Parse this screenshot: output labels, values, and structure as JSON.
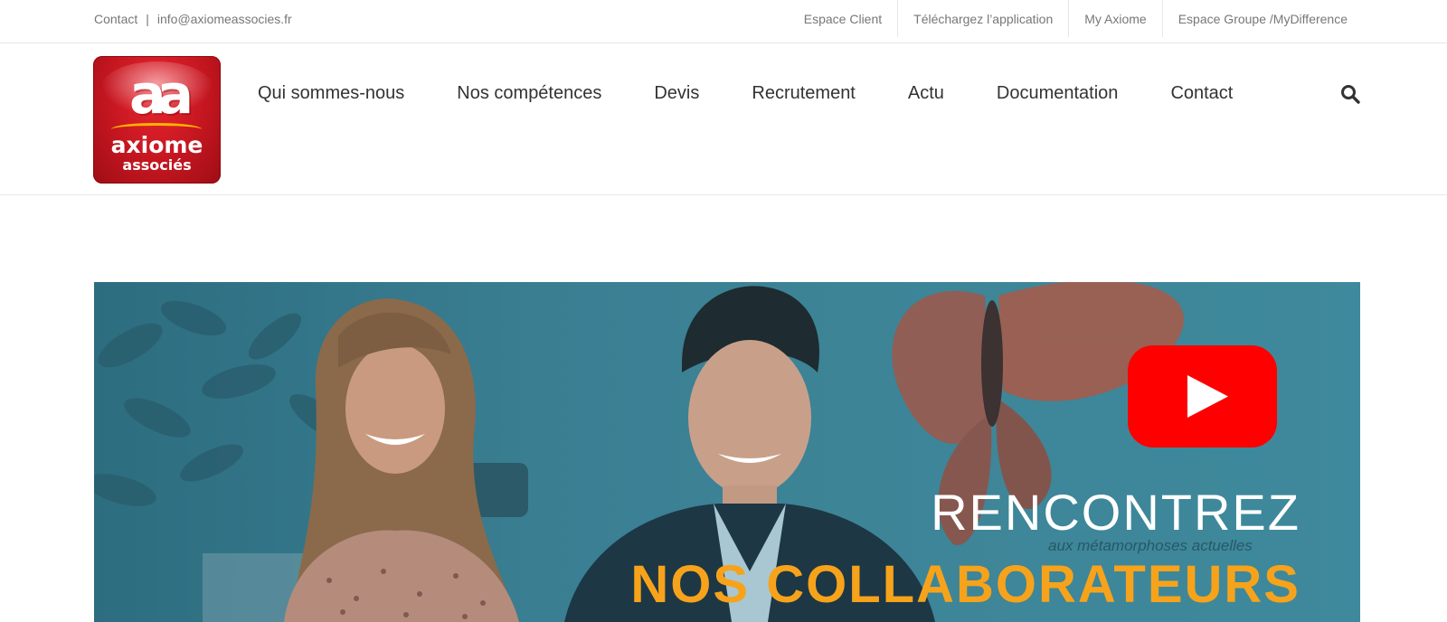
{
  "topbar": {
    "contact_label": "Contact",
    "separator": "|",
    "email": "info@axiomeassocies.fr",
    "links": [
      "Espace Client",
      "Téléchargez l’application",
      "My Axiome",
      "Espace Groupe /MyDifference"
    ]
  },
  "logo": {
    "mark": "aa",
    "name_line1": "axiome",
    "name_line2": "associés"
  },
  "nav": {
    "items": [
      "Qui sommes-nous",
      "Nos compétences",
      "Devis",
      "Recrutement",
      "Actu",
      "Documentation",
      "Contact"
    ],
    "search_icon": "search-icon"
  },
  "hero": {
    "title_line1": "RENCONTREZ",
    "title_line2": "NOS COLLABORATEURS",
    "wall_text": "aux métamorphoses actuelles",
    "play_icon": "youtube-play-icon",
    "colors": {
      "overlay": "#3a7e92",
      "title_accent": "#f6a31b",
      "play_red": "#ff0000"
    }
  },
  "colors": {
    "brand_red": "#c41620",
    "text_nav": "#333333",
    "text_topbar": "#777777"
  }
}
